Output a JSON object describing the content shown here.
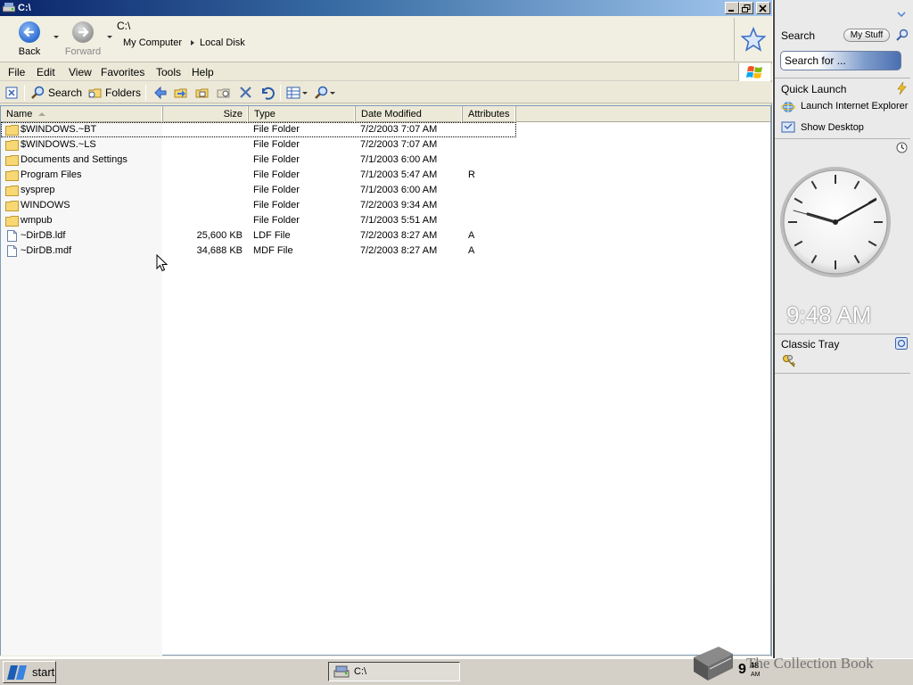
{
  "window": {
    "title": "C:\\"
  },
  "nav": {
    "back_label": "Back",
    "forward_label": "Forward",
    "path": "C:\\",
    "crumb_1": "My Computer",
    "crumb_2": "Local Disk"
  },
  "menu": {
    "file": "File",
    "edit": "Edit",
    "view": "View",
    "favorites": "Favorites",
    "tools": "Tools",
    "help": "Help"
  },
  "toolbar": {
    "search_label": "Search",
    "folders_label": "Folders"
  },
  "columns": {
    "name": "Name",
    "size": "Size",
    "type": "Type",
    "date": "Date Modified",
    "attributes": "Attributes"
  },
  "files": [
    {
      "name": "$WINDOWS.~BT",
      "size": "",
      "type": "File Folder",
      "date": "7/2/2003 7:07 AM",
      "attr": "",
      "kind": "folder"
    },
    {
      "name": "$WINDOWS.~LS",
      "size": "",
      "type": "File Folder",
      "date": "7/2/2003 7:07 AM",
      "attr": "",
      "kind": "folder"
    },
    {
      "name": "Documents and Settings",
      "size": "",
      "type": "File Folder",
      "date": "7/1/2003 6:00 AM",
      "attr": "",
      "kind": "folder"
    },
    {
      "name": "Program Files",
      "size": "",
      "type": "File Folder",
      "date": "7/1/2003 5:47 AM",
      "attr": "R",
      "kind": "folder"
    },
    {
      "name": "sysprep",
      "size": "",
      "type": "File Folder",
      "date": "7/1/2003 6:00 AM",
      "attr": "",
      "kind": "folder"
    },
    {
      "name": "WINDOWS",
      "size": "",
      "type": "File Folder",
      "date": "7/2/2003 9:34 AM",
      "attr": "",
      "kind": "folder"
    },
    {
      "name": "wmpub",
      "size": "",
      "type": "File Folder",
      "date": "7/1/2003 5:51 AM",
      "attr": "",
      "kind": "folder"
    },
    {
      "name": "~DirDB.ldf",
      "size": "25,600 KB",
      "type": "LDF File",
      "date": "7/2/2003 8:27 AM",
      "attr": "A",
      "kind": "file"
    },
    {
      "name": "~DirDB.mdf",
      "size": "34,688 KB",
      "type": "MDF File",
      "date": "7/2/2003 8:27 AM",
      "attr": "A",
      "kind": "file"
    }
  ],
  "sidebar": {
    "search_title": "Search",
    "mystuff_label": "My Stuff",
    "search_placeholder": "Search for ...",
    "quicklaunch_title": "Quick Launch",
    "ql_items": [
      "Launch Internet Explorer Browser",
      "Show Desktop"
    ],
    "clock_time": "9:48 AM",
    "classictray_title": "Classic Tray"
  },
  "taskbar": {
    "start_label": "start",
    "task_label": "C:\\",
    "tray_hour": "9",
    "tray_min": "48",
    "tray_ampm": "AM",
    "watermark": "The Collection Book"
  },
  "colors": {
    "title_gradient_start": "#0a246a",
    "title_gradient_end": "#a6caf0",
    "back_button": "#3b78d8",
    "forward_button": "#a0a0a0"
  }
}
